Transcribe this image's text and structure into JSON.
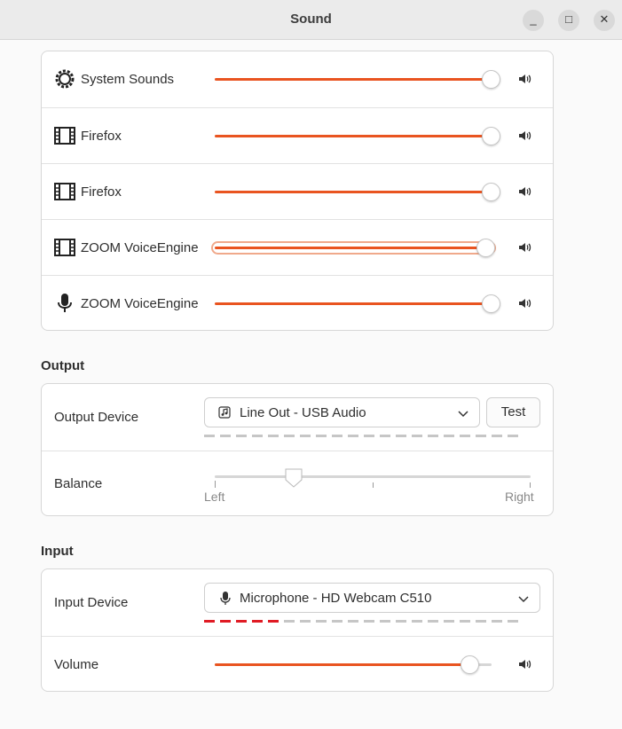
{
  "window": {
    "title": "Sound"
  },
  "window_controls": {
    "minimize": "_",
    "maximize": "□",
    "close": "✕"
  },
  "apps": [
    {
      "name": "System Sounds",
      "icon": "system-sounds-icon",
      "level": 1.0
    },
    {
      "name": "Firefox",
      "icon": "film-icon",
      "level": 1.0
    },
    {
      "name": "Firefox",
      "icon": "film-icon",
      "level": 1.0
    },
    {
      "name": "ZOOM VoiceEngine",
      "icon": "film-icon",
      "level": 0.98,
      "focused": true
    },
    {
      "name": "ZOOM VoiceEngine",
      "icon": "microphone-icon",
      "level": 1.0
    }
  ],
  "output": {
    "section_title": "Output",
    "device_label": "Output Device",
    "device_value": "Line Out - USB Audio",
    "test_label": "Test",
    "balance_label": "Balance",
    "balance_left": "Left",
    "balance_right": "Right",
    "balance_position": 0.25,
    "level_active_segments": 0
  },
  "input": {
    "section_title": "Input",
    "device_label": "Input Device",
    "device_value": "Microphone - HD Webcam C510",
    "volume_label": "Volume",
    "volume_level": 0.92,
    "level_active_segments": 5
  },
  "colors": {
    "accent": "#e95420",
    "level_on": "#e01b24",
    "level_off": "#c6c6c6"
  }
}
